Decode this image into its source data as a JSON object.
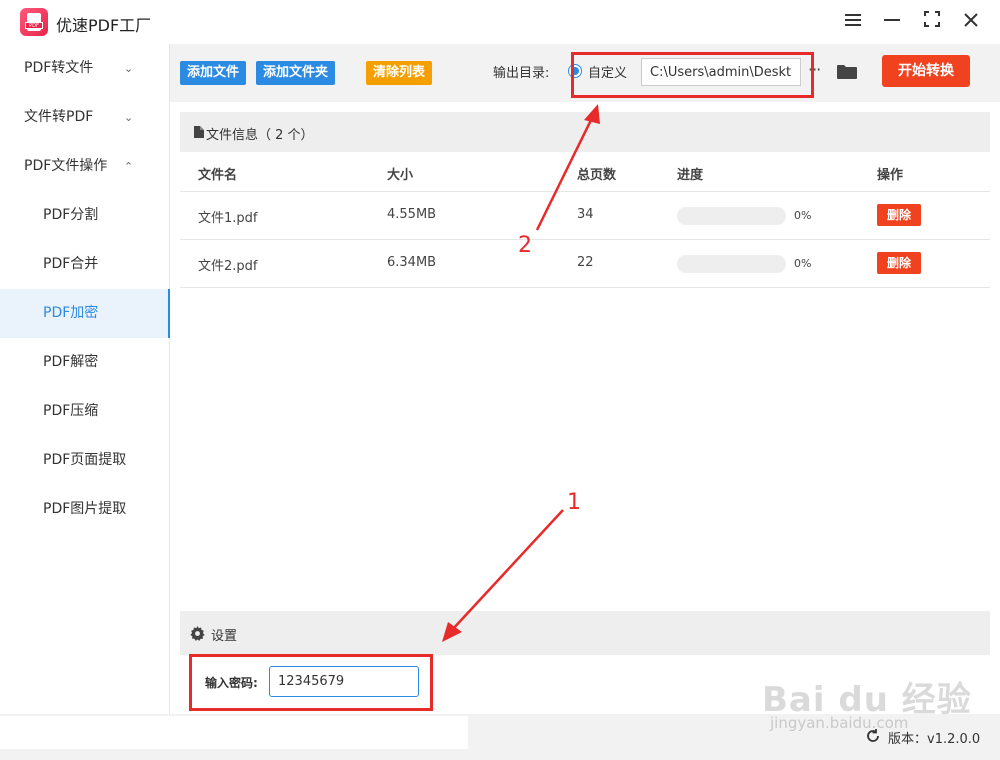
{
  "app": {
    "title": "优速PDF工厂",
    "logo_text": "PDF"
  },
  "window_controls": [
    "menu-icon",
    "minimize-icon",
    "maximize-icon",
    "close-icon"
  ],
  "sidebar": {
    "items": [
      {
        "label": "PDF转文件",
        "level": 1,
        "chevron": "down"
      },
      {
        "label": "文件转PDF",
        "level": 1,
        "chevron": "down"
      },
      {
        "label": "PDF文件操作",
        "level": 1,
        "chevron": "up"
      },
      {
        "label": "PDF分割",
        "level": 2
      },
      {
        "label": "PDF合并",
        "level": 2
      },
      {
        "label": "PDF加密",
        "level": 2,
        "active": true
      },
      {
        "label": "PDF解密",
        "level": 2
      },
      {
        "label": "PDF压缩",
        "level": 2
      },
      {
        "label": "PDF页面提取",
        "level": 2
      },
      {
        "label": "PDF图片提取",
        "level": 2
      }
    ]
  },
  "toolbar": {
    "add_file": "添加文件",
    "add_folder": "添加文件夹",
    "clear_list": "清除列表",
    "output_label": "输出目录:",
    "custom_radio": "自定义",
    "output_path": "C:\\Users\\admin\\Deskto",
    "more": "···",
    "start": "开始转换"
  },
  "file_panel": {
    "title": "文件信息（ 2 个）",
    "columns": [
      "文件名",
      "大小",
      "总页数",
      "进度",
      "操作"
    ],
    "rows": [
      {
        "name": "文件1.pdf",
        "size": "4.55MB",
        "pages": "34",
        "progress": "0%",
        "action": "删除"
      },
      {
        "name": "文件2.pdf",
        "size": "6.34MB",
        "pages": "22",
        "progress": "0%",
        "action": "删除"
      }
    ]
  },
  "settings": {
    "title": "设置",
    "password_label": "输入密码:",
    "password_value": "12345679"
  },
  "status": {
    "version": "版本：v1.2.0.0"
  },
  "annotations": {
    "label1": "1",
    "label2": "2"
  },
  "watermark": {
    "main": "Bai du 经验",
    "sub": "jingyan.baidu.com"
  },
  "colors": {
    "accent_blue": "#2b8ae2",
    "orange": "#f5a000",
    "red": "#f0421e",
    "highlight": "#e72a2a"
  }
}
